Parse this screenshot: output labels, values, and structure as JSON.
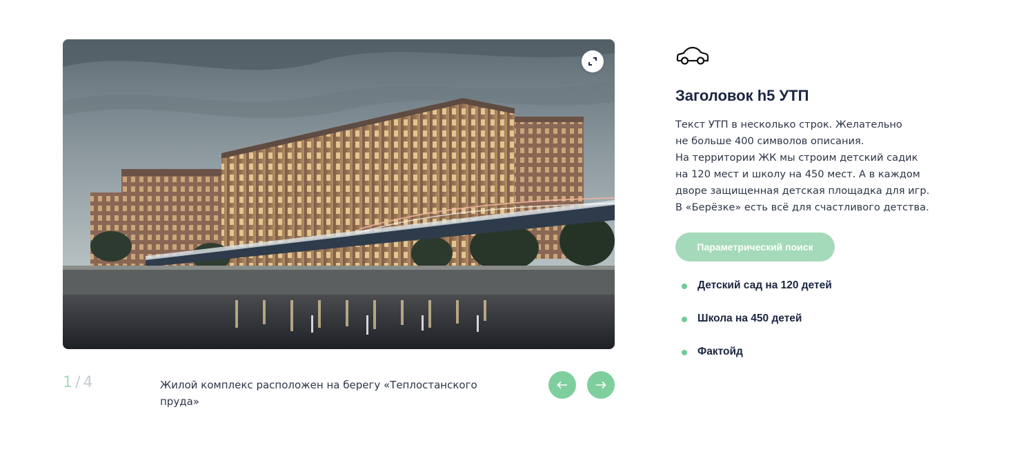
{
  "gallery": {
    "image_alt": "Жилой комплекс на берегу пруда",
    "expand_icon": "expand-icon",
    "counter_current": "1",
    "counter_separator": "/",
    "counter_total": "4",
    "caption": "Жилой комплекс расположен на берегу «Теплостанского пруда»",
    "prev_icon": "arrow-left-icon",
    "next_icon": "arrow-right-icon"
  },
  "info": {
    "icon": "car-icon",
    "title": "Заголовок h5 УТП",
    "description_lines": [
      "Текст УТП в несколько строк. Желательно",
      "не больше 400 символов описания.",
      "На территории ЖК мы строим детский садик",
      "на 120 мест и школу на 450 мест. А в каждом",
      "дворе защищенная детская площадка для игр.",
      "В «Берёзке» есть всё для счастливого детства."
    ],
    "button_label": "Параметрический поиск",
    "features": [
      "Детский сад на 120 детей",
      "Школа на 450 детей",
      "Фактойд"
    ]
  },
  "colors": {
    "accent": "#7fcf9e",
    "accent_light": "#a4dab9",
    "bullet": "#6fcb98",
    "heading": "#1a2540",
    "text": "#2b3447"
  }
}
